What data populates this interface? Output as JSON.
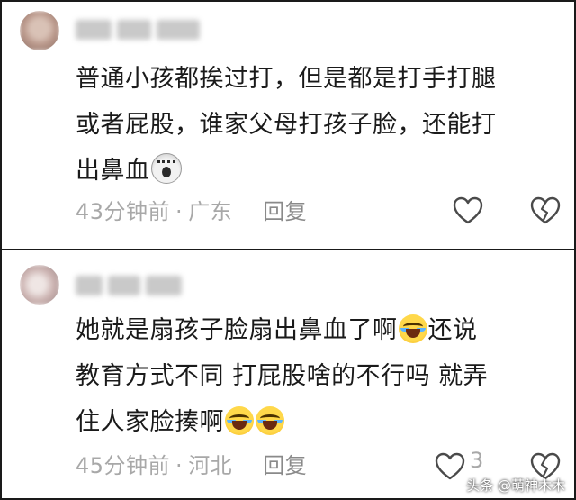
{
  "comments": [
    {
      "username": "",
      "text_lines": [
        "普通小孩都挨过打，但是都是打手打腿",
        "或者屁股，谁家父母打孩子脸，还能打",
        "出鼻血"
      ],
      "time": "43分钟前",
      "location": "广东",
      "reply_label": "回复",
      "like_count": "",
      "emojis": [
        "shocked-emoji"
      ]
    },
    {
      "username": "",
      "text_lines": [
        "她就是扇孩子脸扇出鼻血了啊",
        "还说",
        "教育方式不同 打屁股啥的不行吗 就弄",
        "住人家脸揍啊"
      ],
      "time": "45分钟前",
      "location": "河北",
      "reply_label": "回复",
      "like_count": "3",
      "emojis": [
        "laughing-crying-emoji"
      ]
    }
  ],
  "separator": "·",
  "watermark": "头条 @萌神木木",
  "icons": {
    "like": "heart-outline-icon",
    "dislike": "broken-heart-icon"
  },
  "colors": {
    "text": "#1a1a1a",
    "meta": "#a8a8a8",
    "border": "#1a1a1a"
  }
}
